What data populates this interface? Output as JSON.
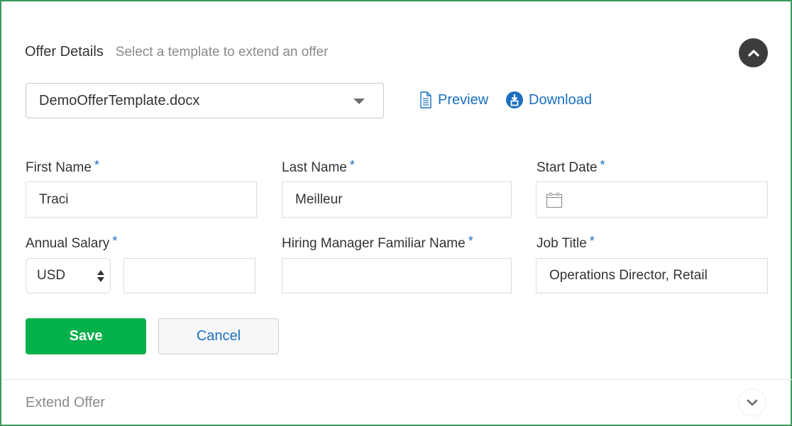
{
  "offer_details": {
    "title": "Offer Details",
    "subtitle": "Select a template to extend an offer",
    "collapse_icon": "chevron-up-icon",
    "template_select": {
      "value": "DemoOfferTemplate.docx",
      "icon": "caret-down-icon"
    },
    "preview_link": {
      "label": "Preview",
      "icon": "document-icon"
    },
    "download_link": {
      "label": "Download",
      "icon": "download-icon"
    }
  },
  "form": {
    "required_marker": "*",
    "first_name": {
      "label": "First Name",
      "value": "Traci",
      "required": true
    },
    "last_name": {
      "label": "Last Name",
      "value": "Meilleur",
      "required": true
    },
    "start_date": {
      "label": "Start Date",
      "value": "",
      "icon": "calendar-icon",
      "required": true
    },
    "annual_salary": {
      "label": "Annual Salary",
      "currency": "USD",
      "amount": "",
      "required": true
    },
    "hiring_manager": {
      "label": "Hiring Manager Familiar Name",
      "value": "",
      "required": true
    },
    "job_title": {
      "label": "Job Title",
      "value": "Operations Director, Retail",
      "required": true
    }
  },
  "actions": {
    "save_label": "Save",
    "cancel_label": "Cancel"
  },
  "extend_offer": {
    "title": "Extend Offer",
    "expand_icon": "chevron-down-icon"
  },
  "colors": {
    "accent_blue": "#1a6fc2",
    "save_green": "#05b14a",
    "frame_green": "#3a9a5a",
    "dark_button": "#3c3c3c"
  }
}
